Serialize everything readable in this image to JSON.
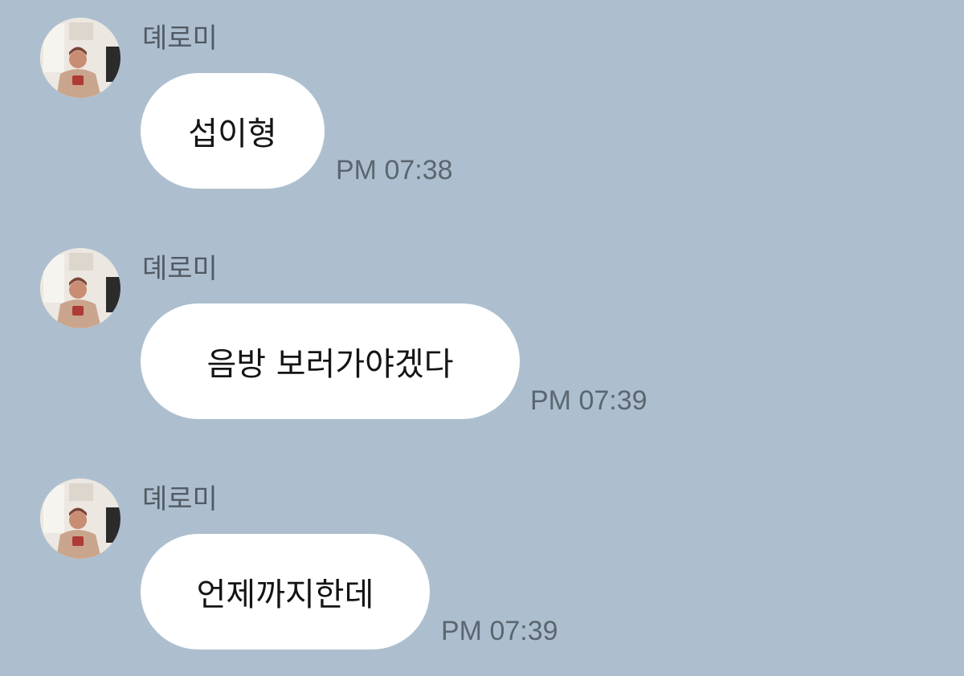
{
  "conversation": {
    "messages": [
      {
        "sender": "뎨로미",
        "text": "섭이형",
        "time": "PM 07:38"
      },
      {
        "sender": "뎨로미",
        "text": "음방 보러가야겠다",
        "time": "PM 07:39"
      },
      {
        "sender": "뎨로미",
        "text": "언제까지한데",
        "time": "PM 07:39"
      }
    ]
  },
  "colors": {
    "background": "#adbfcf",
    "bubble": "#ffffff",
    "sender_text": "#515a63",
    "time_text": "#5b6670"
  },
  "icons": {
    "avatar": "profile-photo-avatar"
  }
}
